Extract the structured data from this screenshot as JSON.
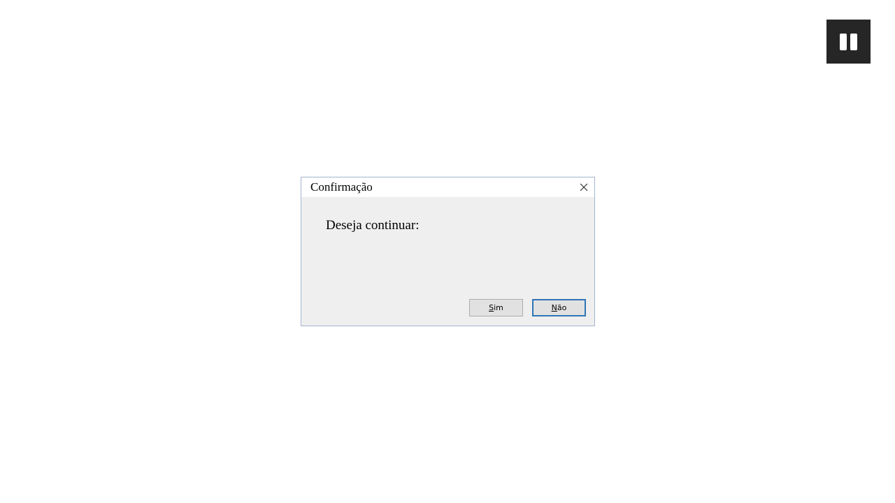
{
  "overlay": {
    "pause_icon": "pause-icon"
  },
  "dialog": {
    "title": "Confirmação",
    "close_icon": "close-icon",
    "message": "Deseja continuar:",
    "buttons": {
      "yes": {
        "accel": "S",
        "rest": "im"
      },
      "no": {
        "accel": "N",
        "rest": "ão"
      }
    },
    "colors": {
      "border": "#a3b6cc",
      "body_background": "#efefef",
      "default_button_border": "#2f75b5"
    }
  }
}
